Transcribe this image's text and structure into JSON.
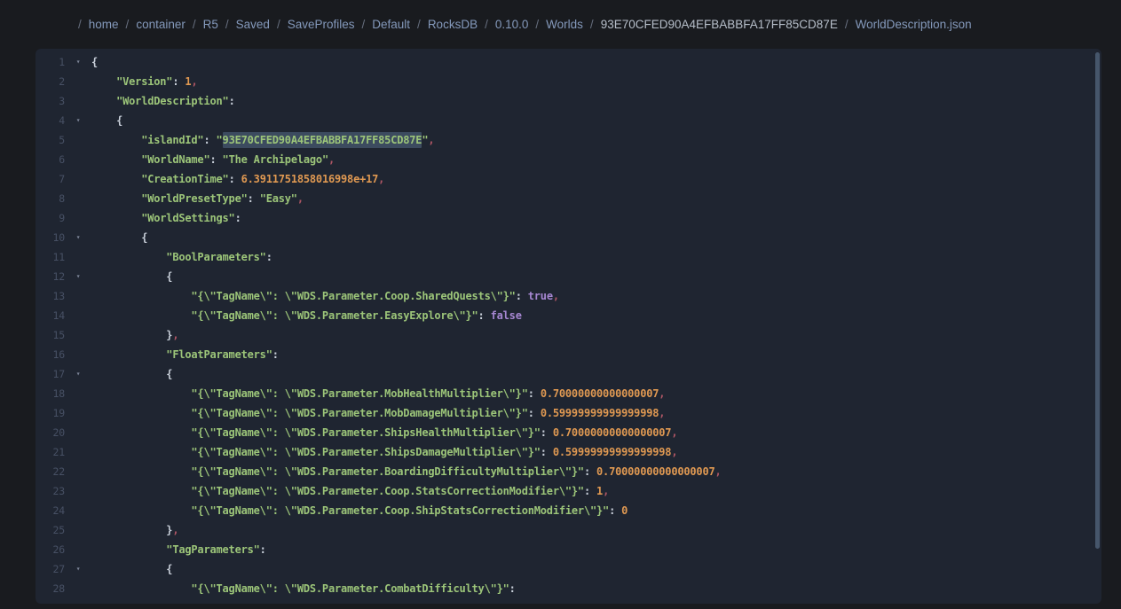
{
  "colors": {
    "page_bg": "#191b1f",
    "editor_bg": "#1f2531",
    "gutter": "#475064",
    "green": "#9cc579",
    "orange": "#e09952",
    "purple": "#a687d2",
    "punct": "#c9d0da",
    "comma": "#b05665",
    "fold": "#7d8598",
    "sel_bg": "#3c4b5f",
    "crumb_link": "#8499bb",
    "crumb_plain": "#b6bec9",
    "crumb_sep": "#666e7e",
    "thumb": "#46566b"
  },
  "breadcrumb": {
    "separator": "/",
    "items": [
      {
        "label": "home",
        "type": "link"
      },
      {
        "label": "container",
        "type": "link"
      },
      {
        "label": "R5",
        "type": "link"
      },
      {
        "label": "Saved",
        "type": "link"
      },
      {
        "label": "SaveProfiles",
        "type": "link"
      },
      {
        "label": "Default",
        "type": "link"
      },
      {
        "label": "RocksDB",
        "type": "link"
      },
      {
        "label": "0.10.0",
        "type": "link"
      },
      {
        "label": "Worlds",
        "type": "link"
      },
      {
        "label": "93E70CFED90A4EFBABBFA17FF85CD87E",
        "type": "current"
      },
      {
        "label": "WorldDescription.json",
        "type": "file"
      }
    ]
  },
  "editor": {
    "fold_icon": "▾",
    "lines": [
      {
        "n": 1,
        "fold": true,
        "indent": 0,
        "tokens": [
          [
            "punc",
            "{"
          ]
        ]
      },
      {
        "n": 2,
        "fold": false,
        "indent": 1,
        "tokens": [
          [
            "str",
            "\"Version\""
          ],
          [
            "punc",
            ": "
          ],
          [
            "num",
            "1"
          ],
          [
            "comma",
            ","
          ]
        ]
      },
      {
        "n": 3,
        "fold": false,
        "indent": 1,
        "tokens": [
          [
            "str",
            "\"WorldDescription\""
          ],
          [
            "punc",
            ":"
          ]
        ]
      },
      {
        "n": 4,
        "fold": true,
        "indent": 1,
        "tokens": [
          [
            "punc",
            "{"
          ]
        ]
      },
      {
        "n": 5,
        "fold": false,
        "indent": 2,
        "tokens": [
          [
            "str",
            "\"islandId\""
          ],
          [
            "punc",
            ": "
          ],
          [
            "str",
            "\""
          ],
          [
            "hl",
            "93E70CFED90A4EFBABBFA17FF85CD87E"
          ],
          [
            "str",
            "\""
          ],
          [
            "comma",
            ","
          ]
        ]
      },
      {
        "n": 6,
        "fold": false,
        "indent": 2,
        "tokens": [
          [
            "str",
            "\"WorldName\""
          ],
          [
            "punc",
            ": "
          ],
          [
            "str",
            "\"The Archipelago\""
          ],
          [
            "comma",
            ","
          ]
        ]
      },
      {
        "n": 7,
        "fold": false,
        "indent": 2,
        "tokens": [
          [
            "str",
            "\"CreationTime\""
          ],
          [
            "punc",
            ": "
          ],
          [
            "num",
            "6.3911751858016998e+17"
          ],
          [
            "comma",
            ","
          ]
        ]
      },
      {
        "n": 8,
        "fold": false,
        "indent": 2,
        "tokens": [
          [
            "str",
            "\"WorldPresetType\""
          ],
          [
            "punc",
            ": "
          ],
          [
            "str",
            "\"Easy\""
          ],
          [
            "comma",
            ","
          ]
        ]
      },
      {
        "n": 9,
        "fold": false,
        "indent": 2,
        "tokens": [
          [
            "str",
            "\"WorldSettings\""
          ],
          [
            "punc",
            ":"
          ]
        ]
      },
      {
        "n": 10,
        "fold": true,
        "indent": 2,
        "tokens": [
          [
            "punc",
            "{"
          ]
        ]
      },
      {
        "n": 11,
        "fold": false,
        "indent": 3,
        "tokens": [
          [
            "str",
            "\"BoolParameters\""
          ],
          [
            "punc",
            ":"
          ]
        ]
      },
      {
        "n": 12,
        "fold": true,
        "indent": 3,
        "tokens": [
          [
            "punc",
            "{"
          ]
        ]
      },
      {
        "n": 13,
        "fold": false,
        "indent": 4,
        "tokens": [
          [
            "str",
            "\"{\\\"TagName\\\": \\\"WDS.Parameter.Coop.SharedQuests\\\"}\""
          ],
          [
            "punc",
            ": "
          ],
          [
            "bool",
            "true"
          ],
          [
            "comma",
            ","
          ]
        ]
      },
      {
        "n": 14,
        "fold": false,
        "indent": 4,
        "tokens": [
          [
            "str",
            "\"{\\\"TagName\\\": \\\"WDS.Parameter.EasyExplore\\\"}\""
          ],
          [
            "punc",
            ": "
          ],
          [
            "bool",
            "false"
          ]
        ]
      },
      {
        "n": 15,
        "fold": false,
        "indent": 3,
        "tokens": [
          [
            "punc",
            "}"
          ],
          [
            "comma",
            ","
          ]
        ]
      },
      {
        "n": 16,
        "fold": false,
        "indent": 3,
        "tokens": [
          [
            "str",
            "\"FloatParameters\""
          ],
          [
            "punc",
            ":"
          ]
        ]
      },
      {
        "n": 17,
        "fold": true,
        "indent": 3,
        "tokens": [
          [
            "punc",
            "{"
          ]
        ]
      },
      {
        "n": 18,
        "fold": false,
        "indent": 4,
        "tokens": [
          [
            "str",
            "\"{\\\"TagName\\\": \\\"WDS.Parameter.MobHealthMultiplier\\\"}\""
          ],
          [
            "punc",
            ": "
          ],
          [
            "num",
            "0.70000000000000007"
          ],
          [
            "comma",
            ","
          ]
        ]
      },
      {
        "n": 19,
        "fold": false,
        "indent": 4,
        "tokens": [
          [
            "str",
            "\"{\\\"TagName\\\": \\\"WDS.Parameter.MobDamageMultiplier\\\"}\""
          ],
          [
            "punc",
            ": "
          ],
          [
            "num",
            "0.59999999999999998"
          ],
          [
            "comma",
            ","
          ]
        ]
      },
      {
        "n": 20,
        "fold": false,
        "indent": 4,
        "tokens": [
          [
            "str",
            "\"{\\\"TagName\\\": \\\"WDS.Parameter.ShipsHealthMultiplier\\\"}\""
          ],
          [
            "punc",
            ": "
          ],
          [
            "num",
            "0.70000000000000007"
          ],
          [
            "comma",
            ","
          ]
        ]
      },
      {
        "n": 21,
        "fold": false,
        "indent": 4,
        "tokens": [
          [
            "str",
            "\"{\\\"TagName\\\": \\\"WDS.Parameter.ShipsDamageMultiplier\\\"}\""
          ],
          [
            "punc",
            ": "
          ],
          [
            "num",
            "0.59999999999999998"
          ],
          [
            "comma",
            ","
          ]
        ]
      },
      {
        "n": 22,
        "fold": false,
        "indent": 4,
        "tokens": [
          [
            "str",
            "\"{\\\"TagName\\\": \\\"WDS.Parameter.BoardingDifficultyMultiplier\\\"}\""
          ],
          [
            "punc",
            ": "
          ],
          [
            "num",
            "0.70000000000000007"
          ],
          [
            "comma",
            ","
          ]
        ]
      },
      {
        "n": 23,
        "fold": false,
        "indent": 4,
        "tokens": [
          [
            "str",
            "\"{\\\"TagName\\\": \\\"WDS.Parameter.Coop.StatsCorrectionModifier\\\"}\""
          ],
          [
            "punc",
            ": "
          ],
          [
            "num",
            "1"
          ],
          [
            "comma",
            ","
          ]
        ]
      },
      {
        "n": 24,
        "fold": false,
        "indent": 4,
        "tokens": [
          [
            "str",
            "\"{\\\"TagName\\\": \\\"WDS.Parameter.Coop.ShipStatsCorrectionModifier\\\"}\""
          ],
          [
            "punc",
            ": "
          ],
          [
            "num",
            "0"
          ]
        ]
      },
      {
        "n": 25,
        "fold": false,
        "indent": 3,
        "tokens": [
          [
            "punc",
            "}"
          ],
          [
            "comma",
            ","
          ]
        ]
      },
      {
        "n": 26,
        "fold": false,
        "indent": 3,
        "tokens": [
          [
            "str",
            "\"TagParameters\""
          ],
          [
            "punc",
            ":"
          ]
        ]
      },
      {
        "n": 27,
        "fold": true,
        "indent": 3,
        "tokens": [
          [
            "punc",
            "{"
          ]
        ]
      },
      {
        "n": 28,
        "fold": false,
        "indent": 4,
        "tokens": [
          [
            "str",
            "\"{\\\"TagName\\\": \\\"WDS.Parameter.CombatDifficulty\\\"}\""
          ],
          [
            "punc",
            ":"
          ]
        ]
      }
    ]
  }
}
